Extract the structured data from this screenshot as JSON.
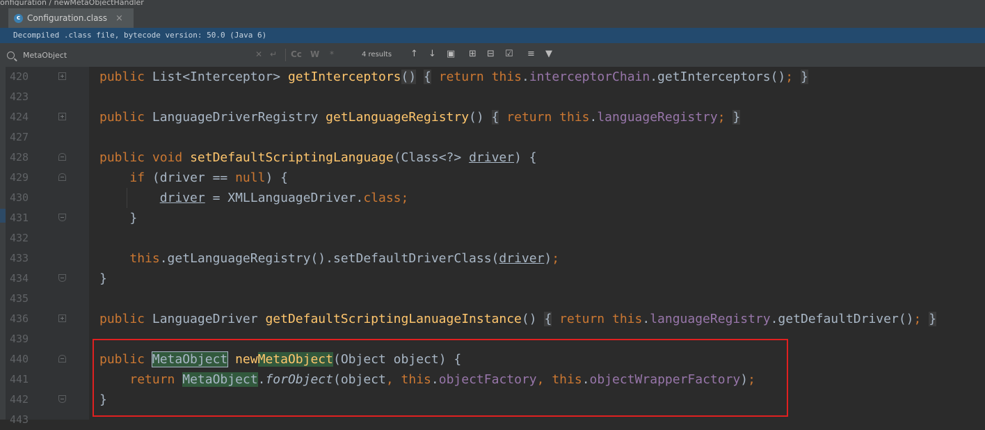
{
  "breadcrumb": {
    "text": "onfiguration  /  newMetaObjectHandler"
  },
  "tab": {
    "label": "Configuration.class",
    "icon": "class-file-icon",
    "close": "×"
  },
  "banner": {
    "text": "Decompiled .class file, bytecode version: 50.0 (Java 6)"
  },
  "search": {
    "query": "MetaObject",
    "results": "4 results",
    "case_label": "Cc",
    "word_label": "W",
    "regex_label": "*"
  },
  "lines": [
    {
      "num": "420",
      "fold": "plus"
    },
    {
      "num": "423",
      "fold": ""
    },
    {
      "num": "424",
      "fold": "plus"
    },
    {
      "num": "427",
      "fold": ""
    },
    {
      "num": "428",
      "fold": "start"
    },
    {
      "num": "429",
      "fold": "start"
    },
    {
      "num": "430",
      "fold": ""
    },
    {
      "num": "431",
      "fold": "end"
    },
    {
      "num": "432",
      "fold": ""
    },
    {
      "num": "433",
      "fold": ""
    },
    {
      "num": "434",
      "fold": "end"
    },
    {
      "num": "435",
      "fold": ""
    },
    {
      "num": "436",
      "fold": "plus"
    },
    {
      "num": "439",
      "fold": ""
    },
    {
      "num": "440",
      "fold": "start"
    },
    {
      "num": "441",
      "fold": ""
    },
    {
      "num": "442",
      "fold": "end"
    },
    {
      "num": "443",
      "fold": ""
    }
  ],
  "code": {
    "l420": {
      "kw": "public",
      "type": "List<Interceptor>",
      "fn": "getInterceptors",
      "paren": "()",
      "ob": "{",
      "ret": "return",
      "this": "this",
      "dot": ".",
      "field": "interceptorChain",
      "call": ".getInterceptors()",
      "semi": ";",
      "cb": "}"
    },
    "l424": {
      "kw": "public",
      "type": "LanguageDriverRegistry",
      "fn": "getLanguageRegistry",
      "paren": "()",
      "ob": "{",
      "ret": "return",
      "this": "this",
      "dot": ".",
      "field": "languageRegistry",
      "semi": ";",
      "cb": "}"
    },
    "l428": {
      "kw1": "public",
      "kw2": "void",
      "fn": "setDefaultScriptingLanguage",
      "p1": "(Class<?> ",
      "arg": "driver",
      "p2": ") {"
    },
    "l429": {
      "kw": "if",
      "p1": " (driver == ",
      "null": "null",
      "p2": ") {"
    },
    "l430": {
      "arg": "driver",
      "eq": " = XMLLanguageDriver.",
      "cls": "class",
      "semi": ";"
    },
    "l431": {
      "cb": "}"
    },
    "l433": {
      "this": "this",
      "call": ".getLanguageRegistry().setDefaultDriverClass(",
      "arg": "driver",
      "close": ")",
      "semi": ";"
    },
    "l434": {
      "cb": "}"
    },
    "l436": {
      "kw": "public",
      "type": "LanguageDriver",
      "fn": "getDefaultScriptingLanuageInstance",
      "paren": "()",
      "ob": "{",
      "ret": "return",
      "this": "this",
      "dot": ".",
      "field": "languageRegistry",
      "call": ".getDefaultDriver()",
      "semi": ";",
      "cb": "}"
    },
    "l440": {
      "kw": "public",
      "type": "MetaObject",
      "fn_a": "new",
      "fn_b": "MetaObject",
      "params": "(Object object) {"
    },
    "l441": {
      "ret": "return",
      "type": "MetaObject",
      "dot": ".",
      "call": "forObject",
      "p1": "(object",
      "c1": ",",
      "this1": "this",
      "d1": ".",
      "f1": "objectFactory",
      "c2": ",",
      "this2": "this",
      "d2": ".",
      "f2": "objectWrapperFactory",
      "close": ")",
      "semi": ";"
    },
    "l442": {
      "cb": "}"
    }
  }
}
